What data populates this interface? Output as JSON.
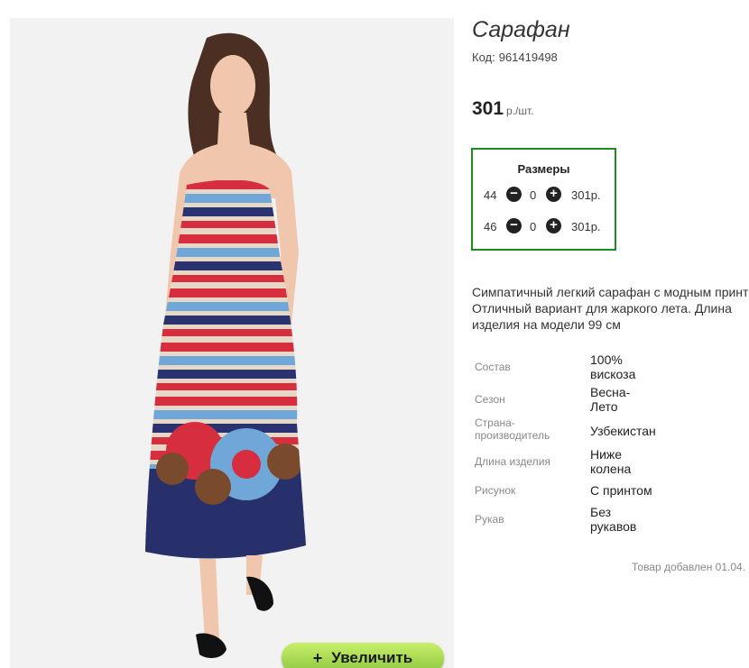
{
  "product": {
    "title": "Сарафан",
    "code_label": "Код:",
    "code_value": "961419498",
    "price": "301",
    "price_unit": "р./шт."
  },
  "sizes": {
    "header": "Размеры",
    "rows": [
      {
        "size": "44",
        "qty": "0",
        "price": "301р."
      },
      {
        "size": "46",
        "qty": "0",
        "price": "301р."
      }
    ]
  },
  "description": [
    "Симпатичный легкий сарафан с модным принт",
    "Отличный вариант для жаркого лета. Длина",
    "изделия на модели 99 см"
  ],
  "properties": [
    {
      "label": "Состав",
      "value": "100% вискоза"
    },
    {
      "label": "Сезон",
      "value": "Весна-Лето"
    },
    {
      "label": "Страна-производитель",
      "value": "Узбекистан"
    },
    {
      "label": "Длина изделия",
      "value": "Ниже колена"
    },
    {
      "label": "Рисунок",
      "value": "С принтом"
    },
    {
      "label": "Рукав",
      "value": "Без рукавов"
    }
  ],
  "added_text": "Товар добавлен 01.04.",
  "zoom": {
    "label": "Увеличить",
    "icon": "plus-icon"
  },
  "colors": {
    "sizes_border": "#1f8a1f",
    "zoom_button": "#a6d94f"
  }
}
